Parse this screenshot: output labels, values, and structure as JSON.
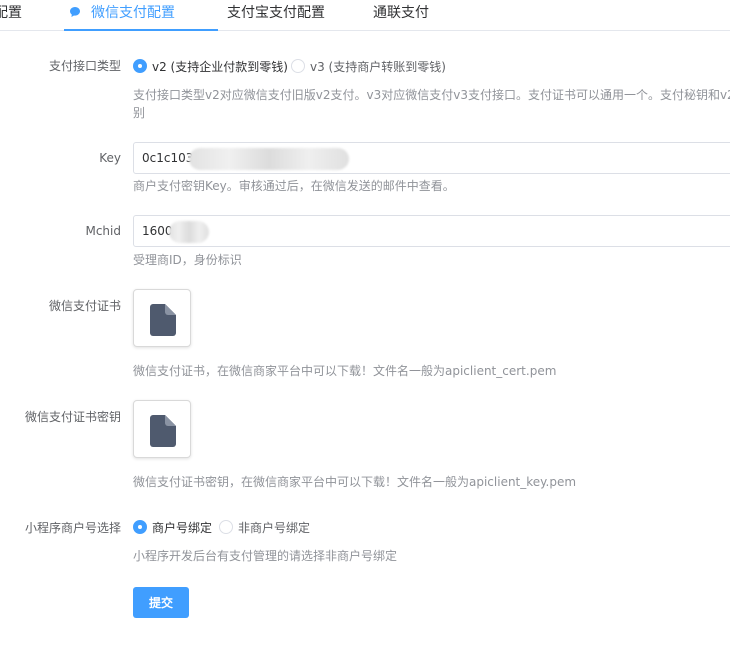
{
  "tabs": [
    {
      "label": "配置"
    },
    {
      "label": "微信支付配置",
      "icon": "chat-bubble-icon"
    },
    {
      "label": "支付宝支付配置"
    },
    {
      "label": "通联支付"
    }
  ],
  "form": {
    "interface_type": {
      "label": "支付接口类型",
      "options": [
        "v2 (支持企业付款到零钱)",
        "v3 (支持商户转账到零钱)"
      ],
      "selected": "v2 (支持企业付款到零钱)",
      "help_line1": "支付接口类型v2对应微信支付旧版v2支付。v3对应微信支付v3支付接口。支付证书可以通用一个。支付秘钥和v2",
      "help_line2": "别"
    },
    "key": {
      "label": "Key",
      "value": "0c1c103",
      "help": "商户支付密钥Key。审核通过后，在微信发送的邮件中查看。"
    },
    "mchid": {
      "label": "Mchid",
      "value": "1600",
      "help": "受理商ID，身份标识"
    },
    "cert": {
      "label": "微信支付证书",
      "icon": "file-icon",
      "help": "微信支付证书，在微信商家平台中可以下载！文件名一般为apiclient_cert.pem"
    },
    "cert_key": {
      "label": "微信支付证书密钥",
      "icon": "file-icon",
      "help": "微信支付证书密钥，在微信商家平台中可以下载！文件名一般为apiclient_key.pem"
    },
    "mini_program": {
      "label": "小程序商户号选择",
      "options": [
        "商户号绑定",
        "非商户号绑定"
      ],
      "selected": "商户号绑定",
      "help": "小程序开发后台有支付管理的请选择非商户号绑定"
    },
    "submit_label": "提交"
  },
  "colors": {
    "accent": "#409eff",
    "text": "#606266",
    "help_text": "#909399",
    "border": "#dcdfe6"
  }
}
